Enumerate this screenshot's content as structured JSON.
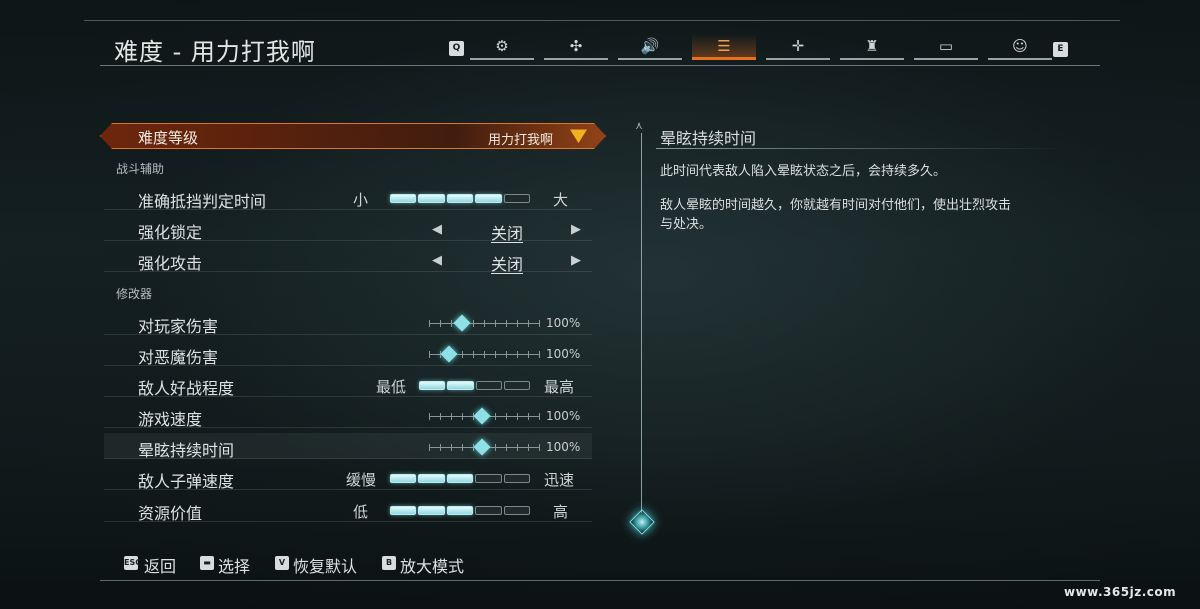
{
  "header": {
    "title": "难度 - 用力打我啊",
    "prev_key": "Q",
    "next_key": "E",
    "tabs": [
      {
        "icon": "gears-icon",
        "glyph": "⚙"
      },
      {
        "icon": "controller-icon",
        "glyph": "✣"
      },
      {
        "icon": "speaker-icon",
        "glyph": "🔊"
      },
      {
        "icon": "difficulty-list-icon",
        "glyph": "☰",
        "active": true
      },
      {
        "icon": "crosshair-icon",
        "glyph": "✛"
      },
      {
        "icon": "joystick-icon",
        "glyph": "♜"
      },
      {
        "icon": "monitor-icon",
        "glyph": "▭"
      },
      {
        "icon": "accessibility-icon",
        "glyph": "☺"
      }
    ]
  },
  "difficulty": {
    "label": "难度等级",
    "value": "用力打我啊"
  },
  "sections": {
    "combat": "战斗辅助",
    "modifiers": "修改器"
  },
  "rows": {
    "parry": {
      "label": "准确抵挡判定时间",
      "min": "小",
      "max": "大",
      "level": 4,
      "of": 5
    },
    "lockon": {
      "label": "强化锁定",
      "value": "关闭"
    },
    "attack": {
      "label": "强化攻击",
      "value": "关闭"
    },
    "player_dmg": {
      "label": "对玩家伤害",
      "pct": "100%",
      "position": 0.3
    },
    "demon_dmg": {
      "label": "对恶魔伤害",
      "pct": "100%",
      "position": 0.18
    },
    "aggression": {
      "label": "敌人好战程度",
      "min": "最低",
      "max": "最高",
      "level": 2,
      "of": 4
    },
    "game_speed": {
      "label": "游戏速度",
      "pct": "100%",
      "position": 0.48
    },
    "stun": {
      "label": "晕眩持续时间",
      "pct": "100%",
      "position": 0.48
    },
    "bullet_speed": {
      "label": "敌人子弹速度",
      "min": "缓慢",
      "max": "迅速",
      "level": 3,
      "of": 5
    },
    "resource": {
      "label": "资源价值",
      "min": "低",
      "max": "高",
      "level": 3,
      "of": 5
    }
  },
  "info": {
    "title": "晕眩持续时间",
    "p1": "此时间代表敌人陷入晕眩状态之后，会持续多久。",
    "p2": "敌人晕眩的时间越久，你就越有时间对付他们，使出壮烈攻击与处决。"
  },
  "footer": {
    "back": {
      "key": "ESC",
      "label": "返回"
    },
    "select": {
      "key": "▬",
      "label": "选择"
    },
    "reset": {
      "key": "V",
      "label": "恢复默认"
    },
    "zoom": {
      "key": "B",
      "label": "放大模式"
    }
  },
  "watermark": "www.365jz.com",
  "colors": {
    "accent": "#e8701f",
    "bar_on": "#8fd8e0"
  }
}
